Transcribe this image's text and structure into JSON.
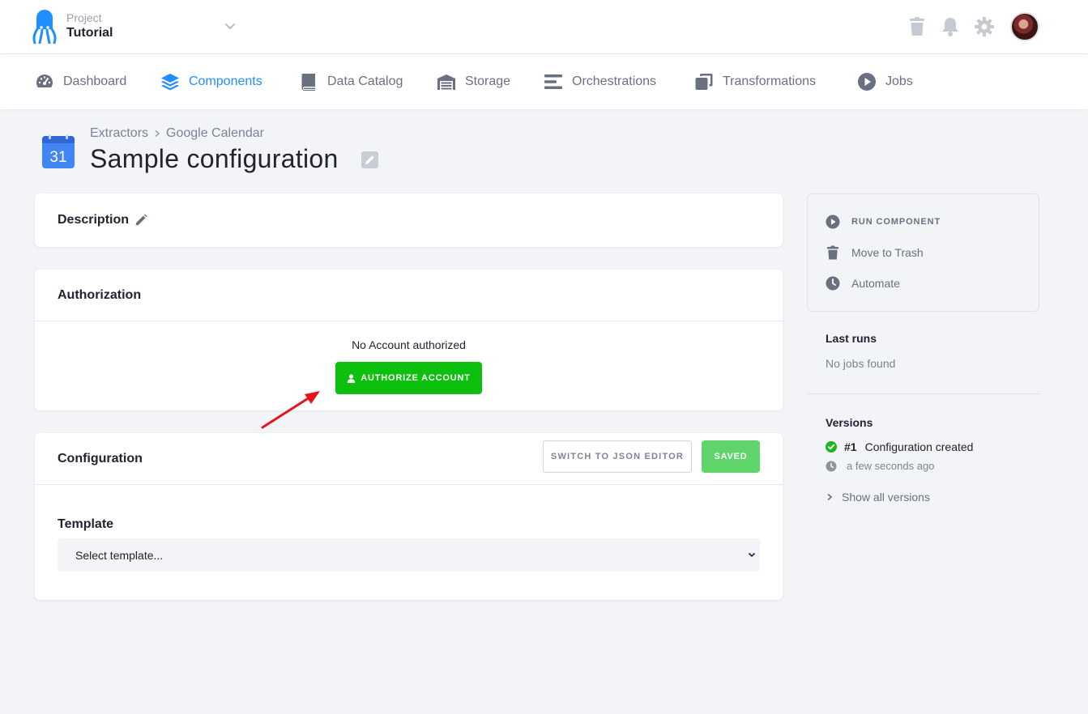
{
  "header": {
    "project_label": "Project",
    "project_name": "Tutorial"
  },
  "nav": {
    "items": [
      {
        "label": "Dashboard",
        "icon": "gauge-icon"
      },
      {
        "label": "Components",
        "icon": "layers-icon",
        "active": true
      },
      {
        "label": "Data Catalog",
        "icon": "book-icon"
      },
      {
        "label": "Storage",
        "icon": "warehouse-icon"
      },
      {
        "label": "Orchestrations",
        "icon": "bars-icon"
      },
      {
        "label": "Transformations",
        "icon": "copy-icon"
      },
      {
        "label": "Jobs",
        "icon": "play-circle-icon"
      }
    ]
  },
  "page": {
    "breadcrumb": [
      "Extractors",
      "Google Calendar"
    ],
    "calendar_day": "31",
    "title": "Sample configuration"
  },
  "description_card": {
    "label": "Description"
  },
  "authorization_card": {
    "title": "Authorization",
    "status": "No Account authorized",
    "authorize_button": "AUTHORIZE ACCOUNT"
  },
  "configuration_card": {
    "title": "Configuration",
    "json_button": "SWITCH TO JSON EDITOR",
    "saved_button": "SAVED",
    "template_label": "Template",
    "template_select": "Select template..."
  },
  "sidebar": {
    "run_component": "RUN COMPONENT",
    "move_to_trash": "Move to Trash",
    "automate": "Automate",
    "last_runs_title": "Last runs",
    "last_runs_empty": "No jobs found",
    "versions_title": "Versions",
    "version_number": "#1",
    "version_desc": "Configuration created",
    "version_time": "a few seconds ago",
    "show_all_versions": "Show all versions"
  },
  "colors": {
    "accent": "#1f8fff",
    "authorize_green": "#0ec00e",
    "saved_green": "#5fd46a",
    "annotation_arrow": "#e8141c"
  }
}
